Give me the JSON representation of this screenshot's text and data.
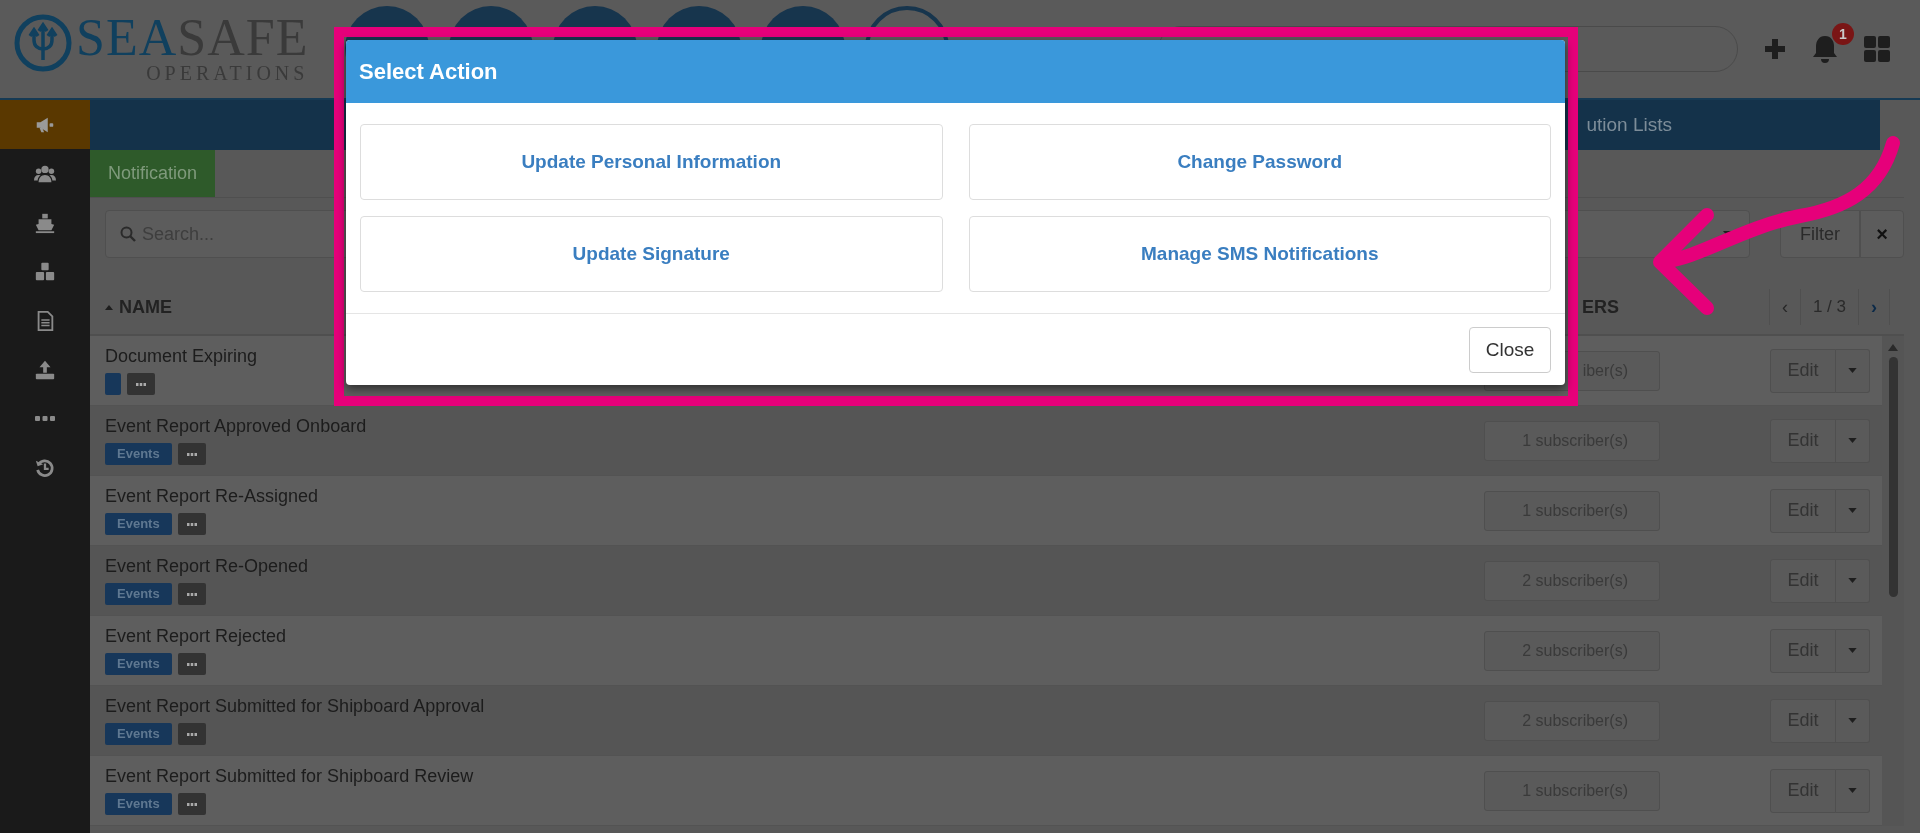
{
  "logo": {
    "primary": "SEA",
    "secondary": "SAFE",
    "subtitle": "OPERATIONS"
  },
  "nav_buttons": [
    {
      "kind": "filled"
    },
    {
      "kind": "filled"
    },
    {
      "kind": "filled"
    },
    {
      "kind": "filled"
    },
    {
      "kind": "filled"
    },
    {
      "kind": "outline"
    }
  ],
  "header_actions": {
    "notification_count": "1"
  },
  "sidebar": {
    "items": [
      {
        "selected": true
      },
      {
        "selected": false
      },
      {
        "selected": false
      },
      {
        "selected": false
      },
      {
        "selected": false
      },
      {
        "selected": false
      },
      {
        "selected": false
      },
      {
        "selected": false
      }
    ]
  },
  "tab_bar": {
    "visible_label": "ution Lists"
  },
  "sub_tabs": [
    {
      "label": "Notification",
      "selected": true
    }
  ],
  "toolbar": {
    "search_placeholder": "Search...",
    "filter_button": "Filter",
    "clear_button": "×"
  },
  "table": {
    "columns": [
      {
        "label": "NAME",
        "sorted": true
      },
      {
        "label": "ERS",
        "sorted": false
      }
    ],
    "pagination": {
      "previous": "‹",
      "page": "1 / 3",
      "next": "›"
    },
    "rows": [
      {
        "name": "Document Expiring",
        "tag": {
          "kind": "blank"
        },
        "subscribers": "iber(s)",
        "action": "Edit"
      },
      {
        "name": "Event Report Approved Onboard",
        "tag": {
          "kind": "label",
          "text": "Events"
        },
        "subscribers": "1 subscriber(s)",
        "action": "Edit"
      },
      {
        "name": "Event Report Re-Assigned",
        "tag": {
          "kind": "label",
          "text": "Events"
        },
        "subscribers": "1 subscriber(s)",
        "action": "Edit"
      },
      {
        "name": "Event Report Re-Opened",
        "tag": {
          "kind": "label",
          "text": "Events"
        },
        "subscribers": "2 subscriber(s)",
        "action": "Edit"
      },
      {
        "name": "Event Report Rejected",
        "tag": {
          "kind": "label",
          "text": "Events"
        },
        "subscribers": "2 subscriber(s)",
        "action": "Edit"
      },
      {
        "name": "Event Report Submitted for Shipboard Approval",
        "tag": {
          "kind": "label",
          "text": "Events"
        },
        "subscribers": "2 subscriber(s)",
        "action": "Edit"
      },
      {
        "name": "Event Report Submitted for Shipboard Review",
        "tag": {
          "kind": "label",
          "text": "Events"
        },
        "subscribers": "1 subscriber(s)",
        "action": "Edit"
      }
    ]
  },
  "modal": {
    "title": "Select Action",
    "actions": [
      "Update Personal Information",
      "Change Password",
      "Update Signature",
      "Manage SMS Notifications"
    ],
    "close_button": "Close"
  }
}
